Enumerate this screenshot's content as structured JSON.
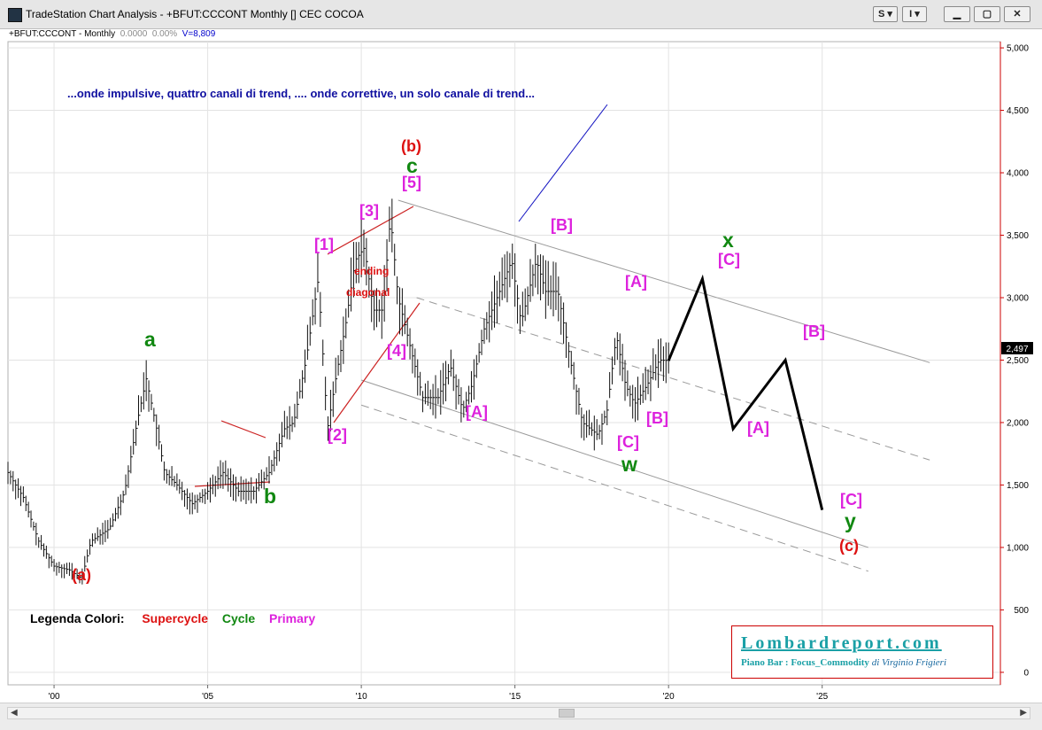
{
  "window": {
    "title": "TradeStation Chart Analysis - +BFUT:CCCONT Monthly [] CEC COCOA",
    "buttons": {
      "s_label": "S",
      "i_label": "I"
    }
  },
  "symbol_bar": {
    "symbol": "+BFUT:CCCONT - Monthly",
    "change": "0.0000",
    "change_pct": "0.00%",
    "volume": "V=8,809"
  },
  "note": "...onde impulsive, quattro canali di trend,  .... onde correttive, un solo canale di trend...",
  "price_marker": "2,497",
  "legend": {
    "title": "Legenda Colori:",
    "supercycle": "Supercycle",
    "cycle": "Cycle",
    "primary": "Primary"
  },
  "colors": {
    "supercycle": "#dd1111",
    "cycle": "#118811",
    "primary": "#dd22dd",
    "note": "#1010a0",
    "price_axis": "#cc0000"
  },
  "logo": {
    "title": "Lombardreport.com",
    "subtitle": "Piano Bar : Focus_Commodity",
    "author": "di Virginio Frigieri"
  },
  "annotations": {
    "supercycle": [
      {
        "text": "(a)"
      },
      {
        "text": "(b)"
      },
      {
        "text": "(c)"
      }
    ],
    "cycle": [
      {
        "text": "a"
      },
      {
        "text": "b"
      },
      {
        "text": "c"
      },
      {
        "text": "w"
      },
      {
        "text": "x"
      },
      {
        "text": "y"
      }
    ],
    "primary": [
      {
        "text": "[1]"
      },
      {
        "text": "[2]"
      },
      {
        "text": "[3]"
      },
      {
        "text": "[4]"
      },
      {
        "text": "[5]"
      },
      {
        "text": "[A]"
      },
      {
        "text": "[B]"
      },
      {
        "text": "[A]"
      },
      {
        "text": "[C]"
      },
      {
        "text": "[B]"
      },
      {
        "text": "[C]"
      },
      {
        "text": "[A]"
      },
      {
        "text": "[B]"
      },
      {
        "text": "[C]"
      }
    ],
    "ending_diagonal": [
      "ending",
      "diagonal"
    ]
  },
  "chart_data": {
    "type": "bar",
    "instrument": "+BFUT:CCCONT",
    "interval": "Monthly",
    "ylim": [
      -100,
      5050
    ],
    "y_ticks": [
      0,
      500,
      1000,
      1500,
      2000,
      2500,
      3000,
      3500,
      4000,
      4500,
      5000
    ],
    "y_tick_labels": [
      "0",
      "500",
      "1,000",
      "1,500",
      "2,000",
      "2,500",
      "3,000",
      "3,500",
      "4,000",
      "4,500",
      "5,000"
    ],
    "x_ticks": [
      2000,
      2005,
      2010,
      2015,
      2020,
      2025
    ],
    "x_tick_labels": [
      "'00",
      "'05",
      "'10",
      "'15",
      "'20",
      "'25"
    ],
    "xlim": [
      1998.5,
      2030.8
    ],
    "last_price": 2497,
    "price_path": [
      [
        1998.5,
        1600
      ],
      [
        1999.0,
        1400
      ],
      [
        1999.5,
        1050
      ],
      [
        2000.0,
        850
      ],
      [
        2000.5,
        820
      ],
      [
        2000.9,
        750
      ],
      [
        2001.2,
        1050
      ],
      [
        2001.8,
        1150
      ],
      [
        2002.3,
        1450
      ],
      [
        2002.7,
        2000
      ],
      [
        2003.0,
        2350
      ],
      [
        2003.3,
        2000
      ],
      [
        2003.6,
        1600
      ],
      [
        2004.0,
        1500
      ],
      [
        2004.5,
        1350
      ],
      [
        2005.0,
        1450
      ],
      [
        2005.5,
        1600
      ],
      [
        2006.0,
        1450
      ],
      [
        2006.5,
        1450
      ],
      [
        2007.0,
        1600
      ],
      [
        2007.5,
        1950
      ],
      [
        2007.8,
        2000
      ],
      [
        2008.2,
        2500
      ],
      [
        2008.6,
        3150
      ],
      [
        2008.9,
        1950
      ],
      [
        2009.2,
        2400
      ],
      [
        2009.5,
        2800
      ],
      [
        2009.8,
        3300
      ],
      [
        2010.1,
        3400
      ],
      [
        2010.4,
        2900
      ],
      [
        2010.7,
        2900
      ],
      [
        2010.95,
        3650
      ],
      [
        2011.2,
        3000
      ],
      [
        2011.6,
        2600
      ],
      [
        2012.0,
        2200
      ],
      [
        2012.5,
        2200
      ],
      [
        2012.9,
        2450
      ],
      [
        2013.3,
        2100
      ],
      [
        2013.6,
        2300
      ],
      [
        2014.0,
        2750
      ],
      [
        2014.5,
        3050
      ],
      [
        2014.9,
        3300
      ],
      [
        2015.2,
        2800
      ],
      [
        2015.7,
        3300
      ],
      [
        2016.0,
        3050
      ],
      [
        2016.4,
        3050
      ],
      [
        2016.8,
        2500
      ],
      [
        2017.2,
        2000
      ],
      [
        2017.7,
        1900
      ],
      [
        2018.0,
        2100
      ],
      [
        2018.3,
        2700
      ],
      [
        2018.6,
        2300
      ],
      [
        2018.9,
        2150
      ],
      [
        2019.3,
        2300
      ],
      [
        2019.7,
        2500
      ],
      [
        2020.0,
        2497
      ]
    ],
    "projection": [
      [
        2020.0,
        2497
      ],
      [
        2021.1,
        3150
      ],
      [
        2022.1,
        1950
      ],
      [
        2023.8,
        2500
      ],
      [
        2025.0,
        1300
      ]
    ],
    "channels": [
      {
        "name": "upper",
        "points": [
          [
            2011.2,
            3780
          ],
          [
            2028.5,
            2480
          ]
        ]
      },
      {
        "name": "mid",
        "points": [
          [
            2011.8,
            3000
          ],
          [
            2028.5,
            1700
          ]
        ]
      },
      {
        "name": "lower",
        "points": [
          [
            2010.0,
            2340
          ],
          [
            2026.5,
            1000
          ]
        ]
      },
      {
        "name": "bottom",
        "points": [
          [
            2010.0,
            2140
          ],
          [
            2026.5,
            810
          ]
        ]
      }
    ]
  }
}
